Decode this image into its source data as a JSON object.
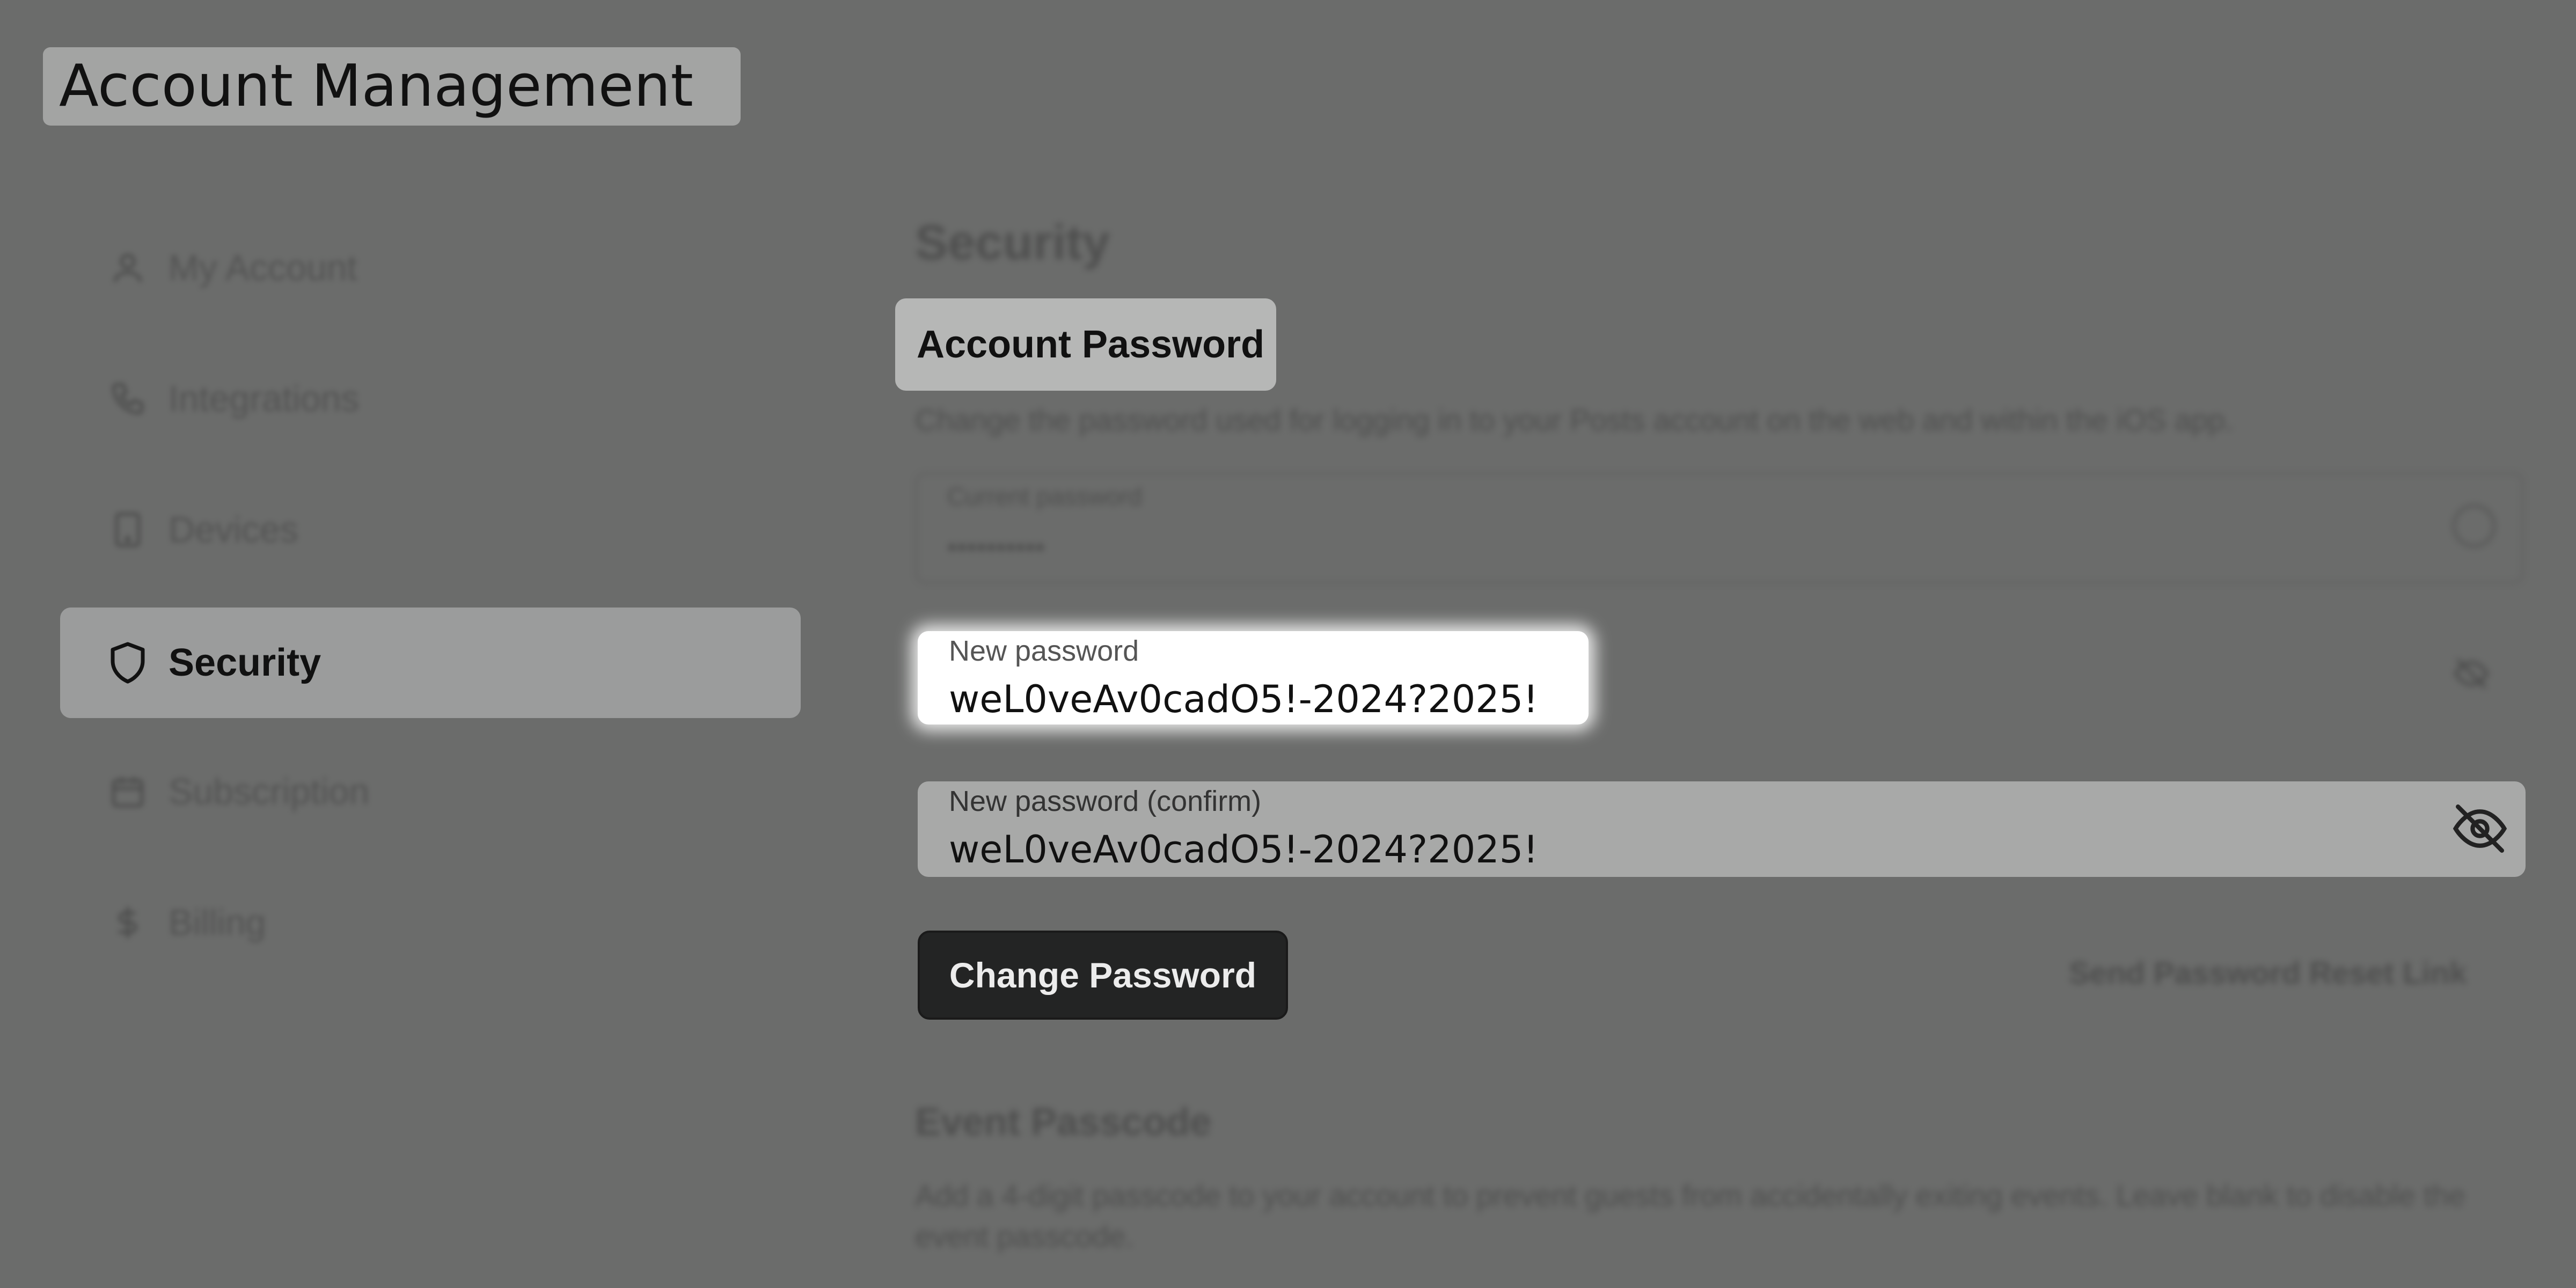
{
  "header": {
    "title": "Account Management"
  },
  "sidebar": {
    "items": [
      {
        "label": "My Account",
        "icon": "user-icon"
      },
      {
        "label": "Integrations",
        "icon": "phone-icon"
      },
      {
        "label": "Devices",
        "icon": "tablet-icon"
      },
      {
        "label": "Security",
        "icon": "shield-icon",
        "active": true
      },
      {
        "label": "Subscription",
        "icon": "calendar-icon"
      },
      {
        "label": "Billing",
        "icon": "dollar-icon"
      }
    ]
  },
  "main": {
    "section_title": "Security",
    "account_password": {
      "title": "Account Password",
      "description": "Change the password used for logging in to your Posts account on the web and within the iOS app.",
      "current_password": {
        "label": "Current password",
        "value": "••••••••••"
      },
      "new_password": {
        "label": "New password",
        "value": "weL0veAv0cadO5!-2024?2025!"
      },
      "confirm_password": {
        "label": "New password (confirm)",
        "value": "weL0veAv0cadO5!-2024?2025!"
      },
      "change_button": "Change Password",
      "reset_link": "Send Password Reset Link"
    },
    "event_passcode": {
      "title": "Event Passcode",
      "description": "Add a 4-digit passcode to your account to prevent guests from accidentally exiting events. Leave blank to disable the event passcode."
    }
  }
}
